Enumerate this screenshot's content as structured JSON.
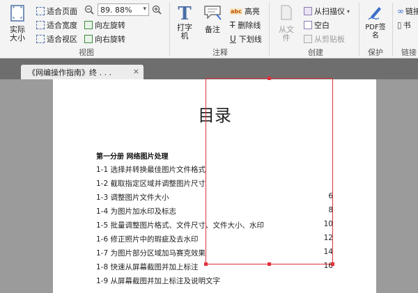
{
  "ribbon": {
    "view": {
      "actual_size": "实际大小",
      "fit_page": "适合页面",
      "fit_width": "适合宽度",
      "fit_view": "适合视区",
      "zoom_value": "89. 88%",
      "rotate_left": "向左旋转",
      "rotate_right": "向右旋转",
      "group_label": "视图"
    },
    "annotate": {
      "typewriter": "打字机",
      "note": "备注",
      "highlight": "高亮",
      "strikeout": "删除线",
      "underline": "下划线",
      "group_label": "注释"
    },
    "create": {
      "from_file": "从文件",
      "from_scanner": "从扫描仪",
      "blank": "空白",
      "from_clipboard": "从剪贴板",
      "group_label": "创建"
    },
    "protect": {
      "pdf_sign": "PDF签名",
      "group_label": "保护"
    },
    "links": {
      "link": "链接",
      "bookmark": "书",
      "group_label": "链接"
    }
  },
  "tab": {
    "title": "《网编操作指南》终 . . .",
    "close": "×"
  },
  "document": {
    "title": "目录",
    "section": "第一分册  网络图片处理",
    "toc": [
      {
        "title": "1-1 选择并转换最佳图片文件格式",
        "page": ""
      },
      {
        "title": "1-2 截取指定区域并调整图片尺寸",
        "page": ""
      },
      {
        "title": "1-3 调整图片文件大小",
        "page": "6"
      },
      {
        "title": "1-4 为图片加水印及标志",
        "page": "8"
      },
      {
        "title": "1-5 批量调整图片格式、文件尺寸、文件大小、水印",
        "page": "10"
      },
      {
        "title": "1-6 修正照片中的瑕疵及去水印",
        "page": "12"
      },
      {
        "title": "1-7 为图片部分区域加马赛克效果",
        "page": "14"
      },
      {
        "title": "1-8 快速从屏幕截图并加上标注",
        "page": "16"
      },
      {
        "title": "1-9 从屏幕截图并加上标注及说明文字",
        "page": ""
      }
    ]
  }
}
